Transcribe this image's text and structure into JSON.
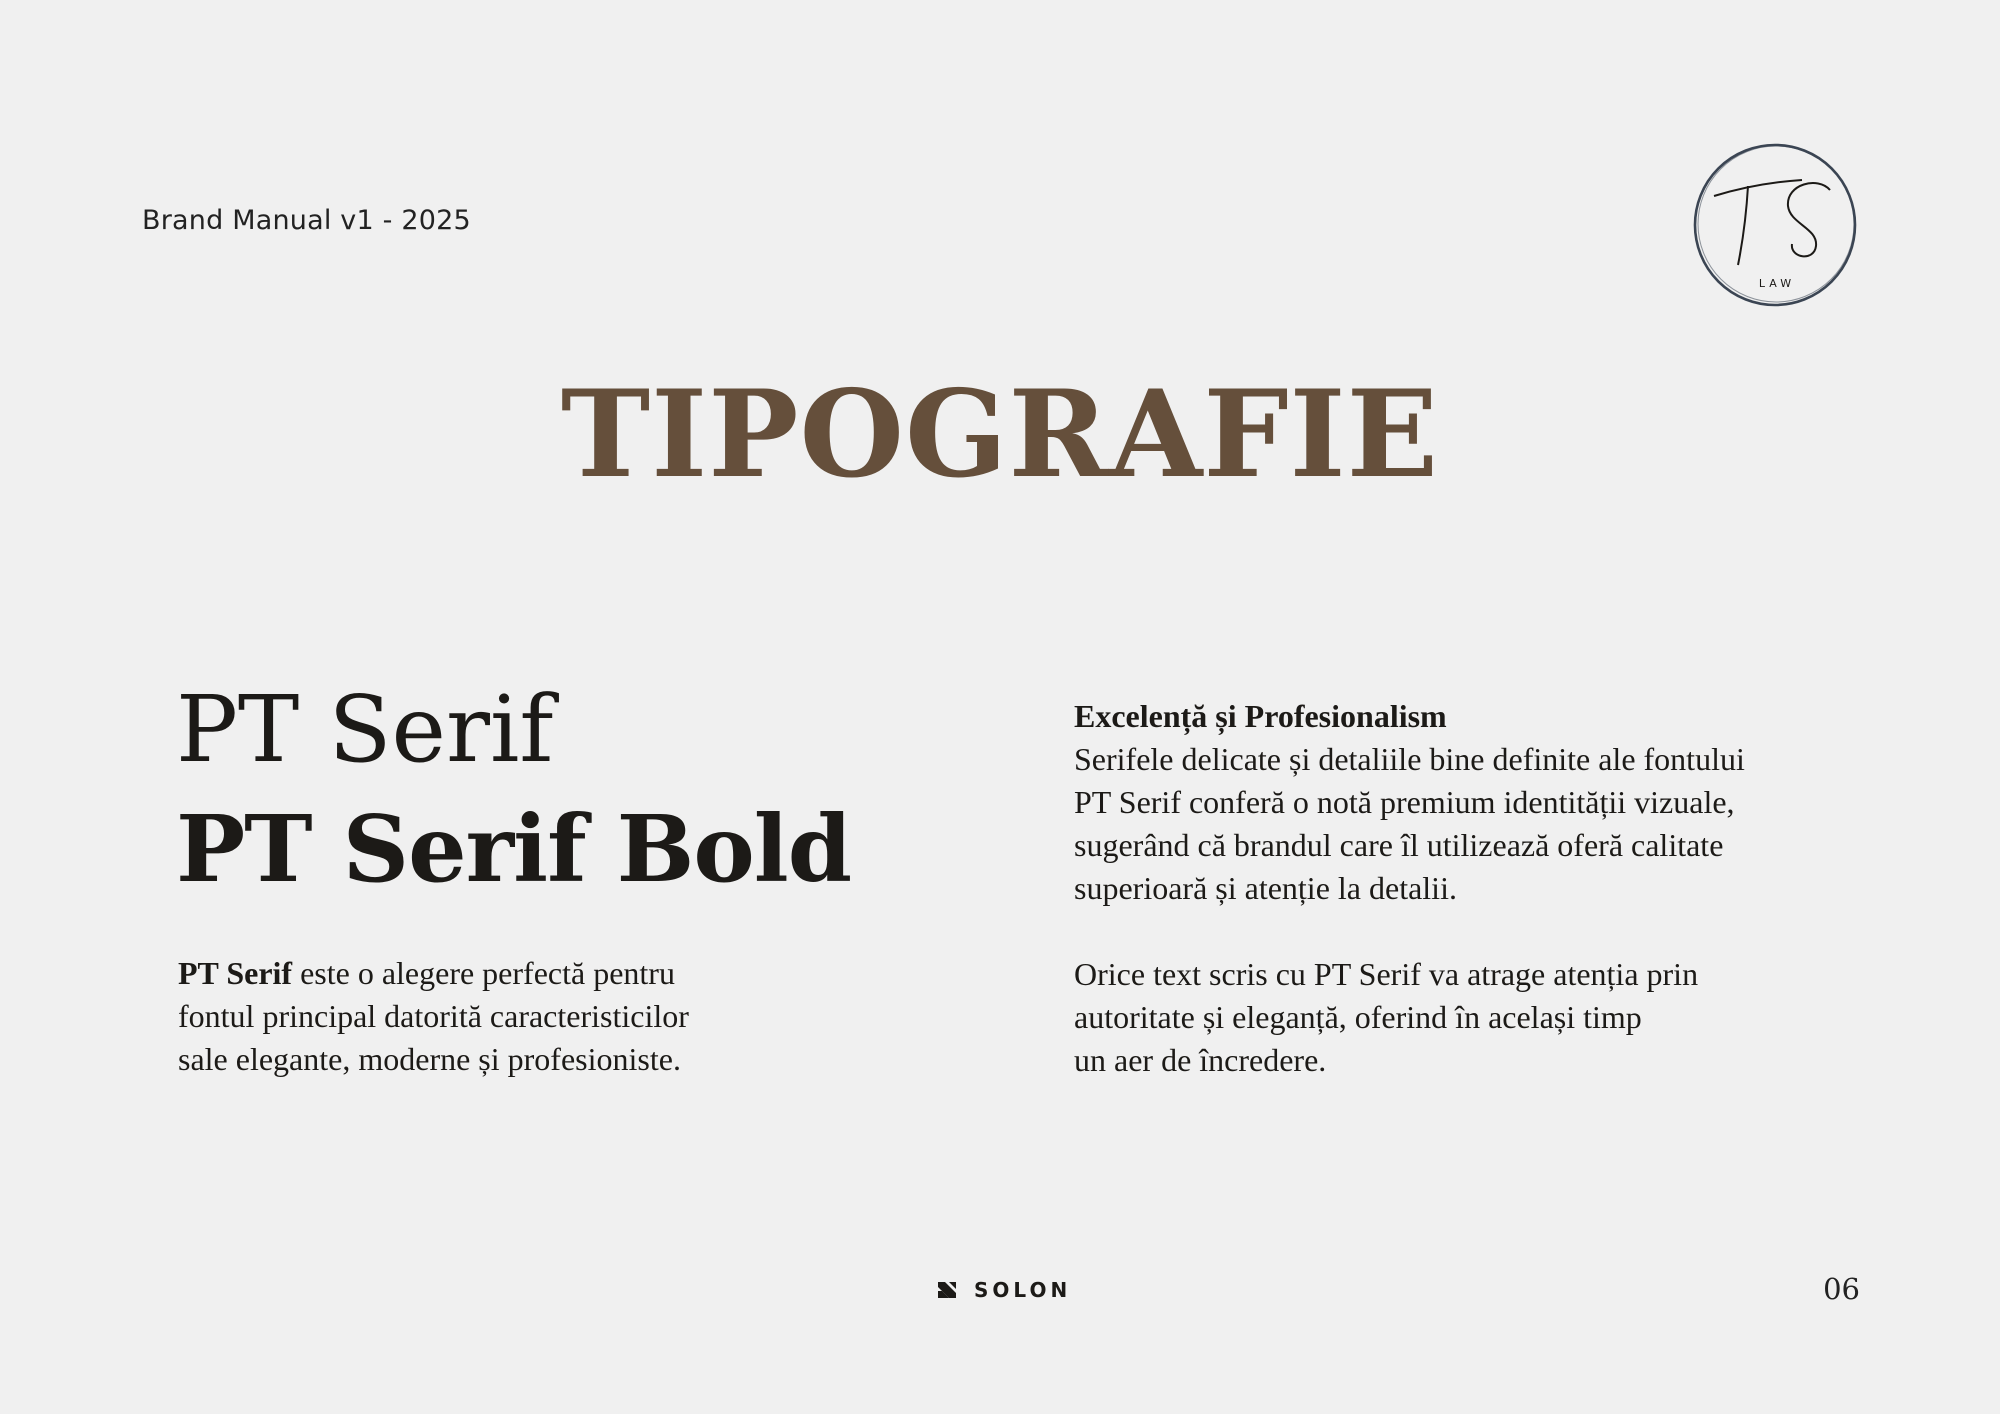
{
  "header": {
    "label": "Brand Manual v1 - 2025"
  },
  "logo": {
    "initials": "TS",
    "subtitle": "LAW",
    "icon": "ts-law-monogram-icon"
  },
  "title": "TIPOGRAFIE",
  "font_samples": {
    "regular": "PT Serif",
    "bold": "PT Serif Bold"
  },
  "left_description": {
    "bold_lead": "PT Serif",
    "line1": " este o alegere perfectă pentru",
    "line2": "fontul principal datorită caracteristicilor",
    "line3": "sale elegante, moderne și profesioniste."
  },
  "right_column": {
    "heading": "Excelență și Profesionalism",
    "paragraph1": [
      "Serifele delicate și detaliile bine definite ale fontului",
      "PT Serif conferă o notă premium identității vizuale,",
      "sugerând că brandul care îl utilizează oferă calitate",
      "superioară și atenție la detalii."
    ],
    "paragraph2": [
      "Orice text scris cu PT Serif va atrage atenția prin",
      "autoritate și eleganță, oferind în același timp",
      "un aer de încredere."
    ]
  },
  "footer": {
    "brand": "SOLON",
    "brand_icon": "solon-logo-icon",
    "page_number": "06"
  },
  "colors": {
    "background": "#f0f0f0",
    "title": "#654f3b",
    "text": "#1c1a17",
    "logo_ring": "#3b4553"
  }
}
